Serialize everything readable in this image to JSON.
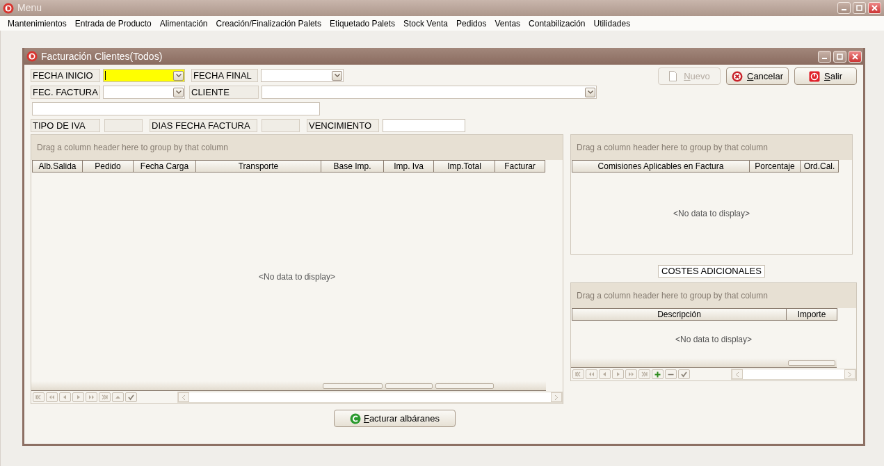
{
  "app_window": {
    "title": "Menu"
  },
  "menu_bar": [
    {
      "label": "Mantenimientos"
    },
    {
      "label": "Entrada de Producto"
    },
    {
      "label": "Alimentación"
    },
    {
      "label": "Creación/Finalización Palets"
    },
    {
      "label": "Etiquetado Palets"
    },
    {
      "label": "Stock Venta"
    },
    {
      "label": "Pedidos"
    },
    {
      "label": "Ventas"
    },
    {
      "label": "Contabilización"
    },
    {
      "label": "Utilidades"
    }
  ],
  "child_window": {
    "title": "Facturación Clientes(Todos)",
    "form_rows": [
      [
        {
          "kind": "label",
          "text": "FECHA INICIO"
        },
        {
          "kind": "combo",
          "focused": true
        },
        {
          "kind": "label",
          "text": "FECHA FINAL"
        },
        {
          "kind": "combo",
          "focused": false
        }
      ],
      [
        {
          "kind": "label",
          "text": "FEC. FACTURA"
        },
        {
          "kind": "combo",
          "focused": false
        },
        {
          "kind": "label",
          "text": "CLIENTE"
        },
        {
          "kind": "combo",
          "focused": false
        }
      ],
      [
        {
          "kind": "input"
        }
      ],
      [
        {
          "kind": "label",
          "text": "TIPO DE IVA"
        },
        {
          "kind": "readonly"
        },
        {
          "kind": "label",
          "text": "DIAS FECHA FACTURA"
        },
        {
          "kind": "readonly"
        },
        {
          "kind": "label",
          "text": "VENCIMIENTO"
        },
        {
          "kind": "input"
        }
      ]
    ],
    "buttons": [
      {
        "kind": "new",
        "label": "Nuevo",
        "disabled": true
      },
      {
        "kind": "cancel",
        "label": "Cancelar",
        "disabled": false
      },
      {
        "kind": "exit",
        "label": "Salir",
        "disabled": false
      }
    ],
    "grids": [
      {
        "group_hint": "Drag a column header here to group by that column",
        "columns": [
          {
            "label": "Alb.Salida",
            "summary": false
          },
          {
            "label": "Pedido",
            "summary": false
          },
          {
            "label": "Fecha Carga",
            "summary": false
          },
          {
            "label": "Transporte",
            "summary": false
          },
          {
            "label": "Base Imp.",
            "summary": true
          },
          {
            "label": "Imp. Iva",
            "summary": true
          },
          {
            "label": "Imp.Total",
            "summary": true
          },
          {
            "label": "Facturar",
            "summary": false
          }
        ],
        "empty_text": "<No data to display>",
        "navigator": {
          "insert_delete": false
        }
      },
      {
        "group_hint": "Drag a column header here to group by that column",
        "columns": [
          {
            "label": "Comisiones Aplicables en Factura"
          },
          {
            "label": "Porcentaje"
          },
          {
            "label": "Ord.Cal."
          }
        ],
        "empty_text": "<No data to display>"
      },
      {
        "group_hint": "Drag a column header here to group by that column",
        "columns": [
          {
            "label": "Descripción",
            "summary": false
          },
          {
            "label": "Importe",
            "summary": true
          }
        ],
        "empty_text": "<No data to display>",
        "navigator": {
          "insert_delete": true
        }
      }
    ],
    "costs_title": "COSTES ADICIONALES",
    "action_button": {
      "label": "Facturar albáranes"
    }
  }
}
